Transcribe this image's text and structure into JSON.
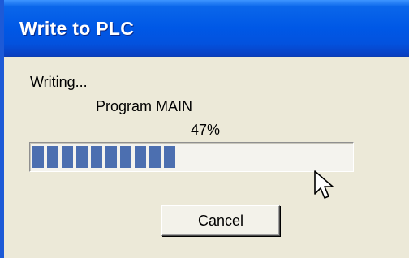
{
  "window": {
    "title": "Write to PLC"
  },
  "dialog": {
    "status_text": "Writing...",
    "program_text": "Program MAIN",
    "percent_text": "47%",
    "progress_fraction": 0.47,
    "cancel_label": "Cancel"
  },
  "colors": {
    "title_bar": "#0058e6",
    "window_bg": "#ece9d8",
    "progress_block": "#4c6fb0"
  },
  "icons": {
    "cursor": "mouse-pointer-icon"
  }
}
